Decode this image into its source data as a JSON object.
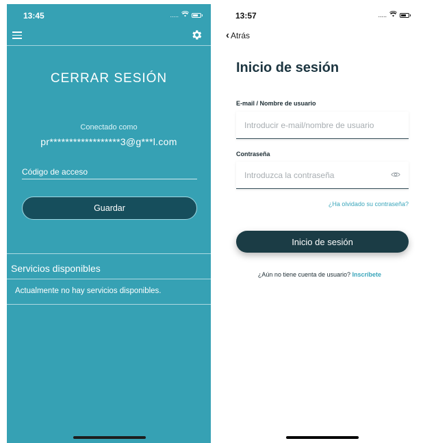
{
  "left_screen": {
    "status_time": "13:45",
    "status_signal": ".....",
    "title": "CERRAR SESIÓN",
    "connected_label": "Conectado como",
    "connected_email": "pr******************3@g***l.com",
    "access_code_placeholder": "Código de acceso",
    "save_label": "Guardar",
    "services_title": "Servicios disponibles",
    "services_empty": "Actualmente no hay servicios disponibles.",
    "colors": {
      "background": "#36a1b4",
      "button": "#164e5c"
    },
    "icons": [
      "hamburger-menu-icon",
      "gear-icon",
      "wifi-icon",
      "battery-icon"
    ]
  },
  "right_screen": {
    "status_time": "13:57",
    "status_signal": ".....",
    "back_label": "Atrás",
    "title": "Inicio de sesión",
    "email_label": "E-mail / Nombre de usuario",
    "email_placeholder": "Introducir e-mail/nombre de usuario",
    "password_label": "Contraseña",
    "password_placeholder": "Introduzca la contraseña",
    "forgot_label": "¿Ha olvidado su contraseña?",
    "login_label": "Inicio de sesión",
    "signup_prompt": "¿Aún no tiene cuenta de usuario?",
    "signup_link": "Inscríbete",
    "colors": {
      "accent": "#3ba6bb",
      "button": "#1b3c45"
    },
    "icons": [
      "back-chevron-icon",
      "eye-icon",
      "wifi-icon",
      "battery-icon"
    ]
  }
}
